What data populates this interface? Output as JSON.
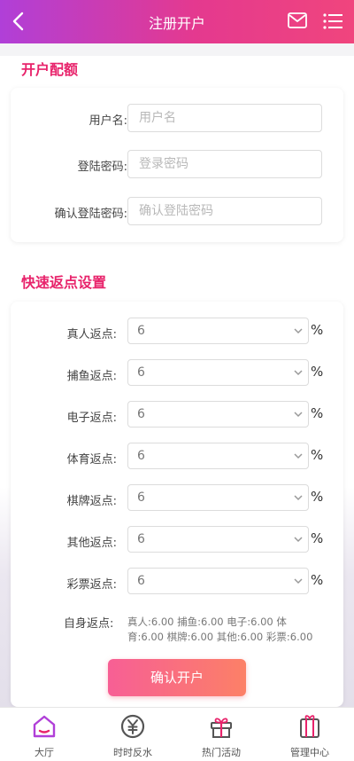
{
  "header": {
    "title": "注册开户",
    "icons": [
      "back-icon",
      "mail-icon",
      "menu-icon"
    ]
  },
  "quota": {
    "title": "开户配额",
    "fields": [
      {
        "label": "用户名:",
        "placeholder": "用户名"
      },
      {
        "label": "登陆密码:",
        "placeholder": "登录密码"
      },
      {
        "label": "确认登陆密码:",
        "placeholder": "确认登陆密码"
      }
    ]
  },
  "rebate": {
    "title": "快速返点设置",
    "unit": "%",
    "rows": [
      {
        "label": "真人返点:",
        "value": "6"
      },
      {
        "label": "捕鱼返点:",
        "value": "6"
      },
      {
        "label": "电子返点:",
        "value": "6"
      },
      {
        "label": "体育返点:",
        "value": "6"
      },
      {
        "label": "棋牌返点:",
        "value": "6"
      },
      {
        "label": "其他返点:",
        "value": "6"
      },
      {
        "label": "彩票返点:",
        "value": "6"
      }
    ],
    "self_label": "自身返点:",
    "self_text": "真人:6.00 捕鱼:6.00 电子:6.00 体育:6.00 棋牌:6.00 其他:6.00 彩票:6.00",
    "confirm_label": "确认开户"
  },
  "tabs": [
    {
      "label": "大厅",
      "icon": "home-icon",
      "active": true
    },
    {
      "label": "时时反水",
      "icon": "yen-coin-icon",
      "active": false
    },
    {
      "label": "热门活动",
      "icon": "gift-icon",
      "active": false
    },
    {
      "label": "管理中心",
      "icon": "gift-box-icon",
      "active": false
    }
  ],
  "colors": {
    "accent": "#e8236b",
    "header_start": "#b03fd8",
    "header_end": "#f0457d",
    "tab_active": "#b03fd8"
  }
}
